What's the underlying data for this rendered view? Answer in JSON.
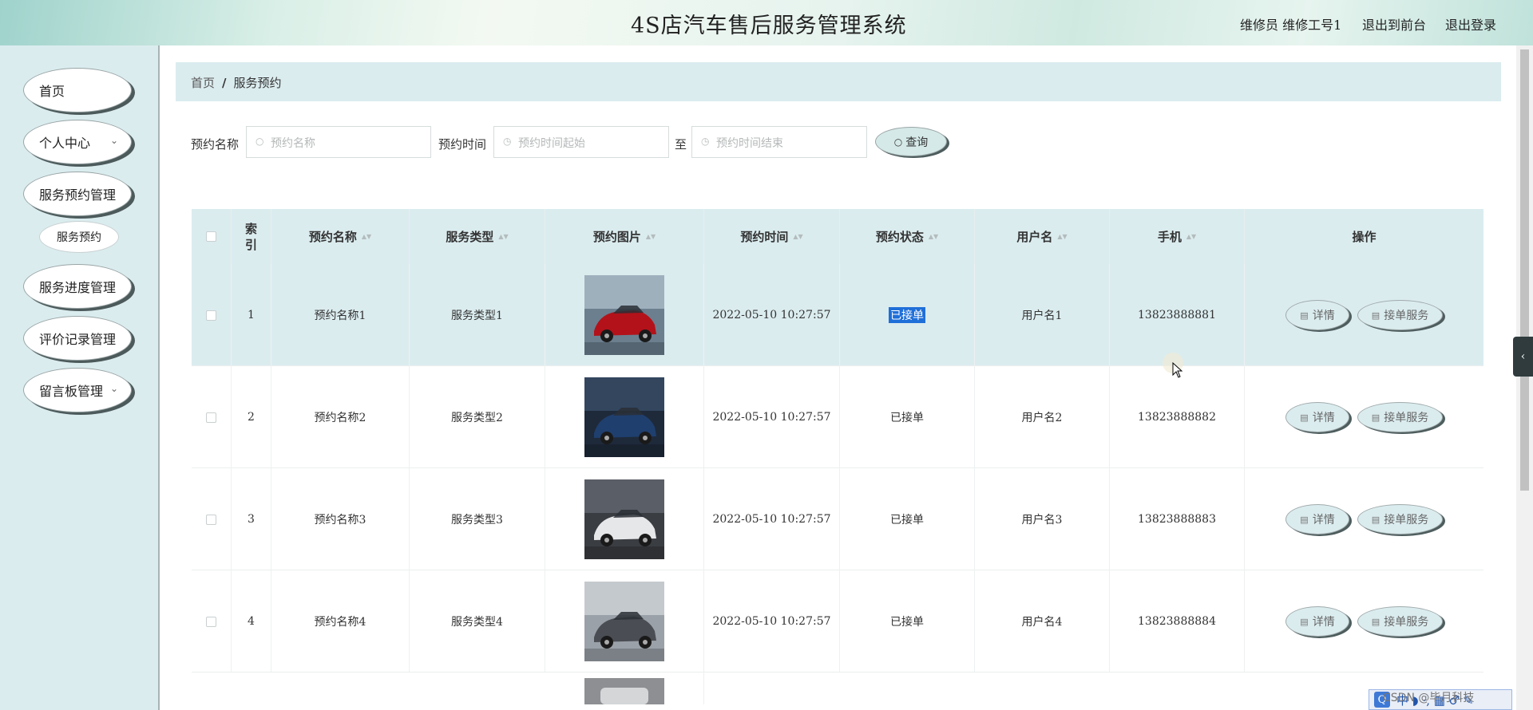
{
  "header": {
    "title": "4S店汽车售后服务管理系统",
    "role_user": "维修员  维修工号1",
    "back_to_front": "退出到前台",
    "logout": "退出登录"
  },
  "sidebar": {
    "items": [
      {
        "label": "首页",
        "has_chevron": false
      },
      {
        "label": "个人中心",
        "has_chevron": true
      },
      {
        "label": "服务预约管理",
        "has_chevron": false
      },
      {
        "label": "服务进度管理",
        "has_chevron": false
      },
      {
        "label": "评价记录管理",
        "has_chevron": false
      },
      {
        "label": "留言板管理",
        "has_chevron": true
      }
    ],
    "sub_items": [
      {
        "label": "服务预约"
      }
    ],
    "chevron": "⌄"
  },
  "breadcrumb": {
    "home": "首页",
    "separator": "/",
    "current": "服务预约"
  },
  "search": {
    "name_label": "预约名称",
    "name_placeholder": "预约名称",
    "time_label": "预约时间",
    "time_start_placeholder": "预约时间起始",
    "to_label": "至",
    "time_end_placeholder": "预约时间结束",
    "query_label": "查询",
    "search_icon": "search-icon",
    "clock_icon": "clock-icon"
  },
  "table": {
    "columns": {
      "index": "索引",
      "name": "预约名称",
      "service_type": "服务类型",
      "image": "预约图片",
      "time": "预约时间",
      "status": "预约状态",
      "username": "用户名",
      "phone": "手机",
      "ops": "操作"
    },
    "rows": [
      {
        "index": "1",
        "name": "预约名称1",
        "service_type": "服务类型1",
        "time": "2022-05-10 10:27:57",
        "status": "已接单",
        "username": "用户名1",
        "phone": "13823888881",
        "highlight": true,
        "status_selected": true
      },
      {
        "index": "2",
        "name": "预约名称2",
        "service_type": "服务类型2",
        "time": "2022-05-10 10:27:57",
        "status": "已接单",
        "username": "用户名2",
        "phone": "13823888882",
        "highlight": false,
        "status_selected": false
      },
      {
        "index": "3",
        "name": "预约名称3",
        "service_type": "服务类型3",
        "time": "2022-05-10 10:27:57",
        "status": "已接单",
        "username": "用户名3",
        "phone": "13823888883",
        "highlight": false,
        "status_selected": false
      },
      {
        "index": "4",
        "name": "预约名称4",
        "service_type": "服务类型4",
        "time": "2022-05-10 10:27:57",
        "status": "已接单",
        "username": "用户名4",
        "phone": "13823888884",
        "highlight": false,
        "status_selected": false
      }
    ],
    "detail_label": "详情",
    "take_label": "接单服务"
  },
  "widgets": {
    "side_toggle": "‹",
    "ime_logo": "Q",
    "ime_text": "中 ◗ ·, ▦ ♂ ✎",
    "watermark": "CSDN @毕月科技"
  },
  "colors": {
    "sidebar_bg": "#dbecef",
    "table_header_bg": "#dbecef",
    "selection_blue": "#1f6fd8"
  }
}
